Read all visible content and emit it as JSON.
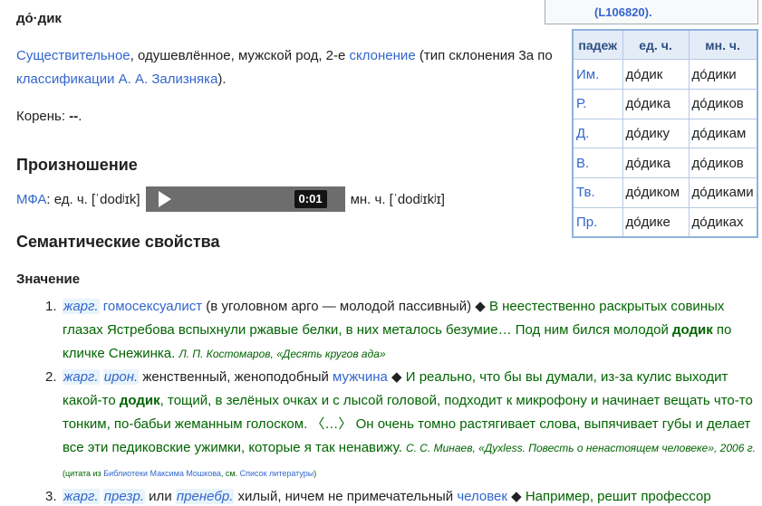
{
  "headword": "до́·дик",
  "morphology": {
    "pos": "Существительное",
    "desc1": ", одушевлённое, мужской род, 2-е ",
    "declension_link": "склонение",
    "desc2": " (тип склонения 3a по ",
    "classification_link": "классификации А. А. Зализняка",
    "desc3": ")."
  },
  "root": {
    "label": "Корень: ",
    "value": "--",
    "end": "."
  },
  "sections": {
    "pronunciation": "Произношение",
    "semantics": "Семантические свойства",
    "meaning": "Значение"
  },
  "pronunciation": {
    "ipa_link": "МФА",
    "sg": ": ед. ч. [ˈdodʲɪk]",
    "pl": "мн. ч. [ˈdodʲɪkʲɪ]",
    "time": "0:01"
  },
  "topbox": {
    "ref": "(L106820)."
  },
  "declension": {
    "headers": [
      "падеж",
      "ед. ч.",
      "мн. ч."
    ],
    "rows": [
      {
        "case": "Им.",
        "sg": "до́дик",
        "pl": "до́дики"
      },
      {
        "case": "Р.",
        "sg": "до́дика",
        "pl": "до́диков"
      },
      {
        "case": "Д.",
        "sg": "до́дику",
        "pl": "до́дикам"
      },
      {
        "case": "В.",
        "sg": "до́дика",
        "pl": "до́диков"
      },
      {
        "case": "Тв.",
        "sg": "до́диком",
        "pl": "до́диками"
      },
      {
        "case": "Пр.",
        "sg": "до́дике",
        "pl": "до́диках"
      }
    ]
  },
  "senses": [
    {
      "num": "1.",
      "tag1": "жарг.",
      "def_link": "гомосексуалист",
      "def": " (в уголовном арго — молодой пассивный) ◆ ",
      "ex1": "В неестественно раскрытых совиных глазах Ястребова вспыхнули ржавые белки, в них металось безумие… Под ним бился молодой ",
      "ex_bold": "додик",
      "ex2": " по кличке Снежинка. ",
      "source": "Л. П. Костомаров, «Десять кругов ада»"
    },
    {
      "num": "2.",
      "tag1": "жарг.",
      "tag2": "ирон.",
      "def": " женственный, женоподобный ",
      "def_link": "мужчина",
      "def_end": " ◆ ",
      "ex1": "И реально, что бы вы думали, из-за кулис выходит какой-то ",
      "ex_bold": "додик",
      "ex2": ", тощий, в зелёных очках и с лысой головой, подходит к микрофону и начинает вещать что-то тонким, по-бабьи жеманным голоском. 〈…〉 Он очень томно растягивает слова, выпячивает губы и делает все эти педиковские ужимки, которые я так ненавижу. ",
      "source": "С. С. Минаев, «Дyxless. Повесть о ненастоящем человеке», 2006 г.",
      "cite_pre": " (цитата из ",
      "cite_link1": "Библиотеки Максима Мошкова",
      "cite_mid": ", см. ",
      "cite_link2": "Список литературы",
      "cite_end": ")"
    },
    {
      "num": "3.",
      "tag1": "жарг.",
      "tag2": "презр.",
      "or": " или ",
      "tag3": "пренебр.",
      "def": " хилый, ничем не примечательный ",
      "def_link": "человек",
      "def_end": " ◆ ",
      "ex1": "Например, решит профессор"
    }
  ]
}
